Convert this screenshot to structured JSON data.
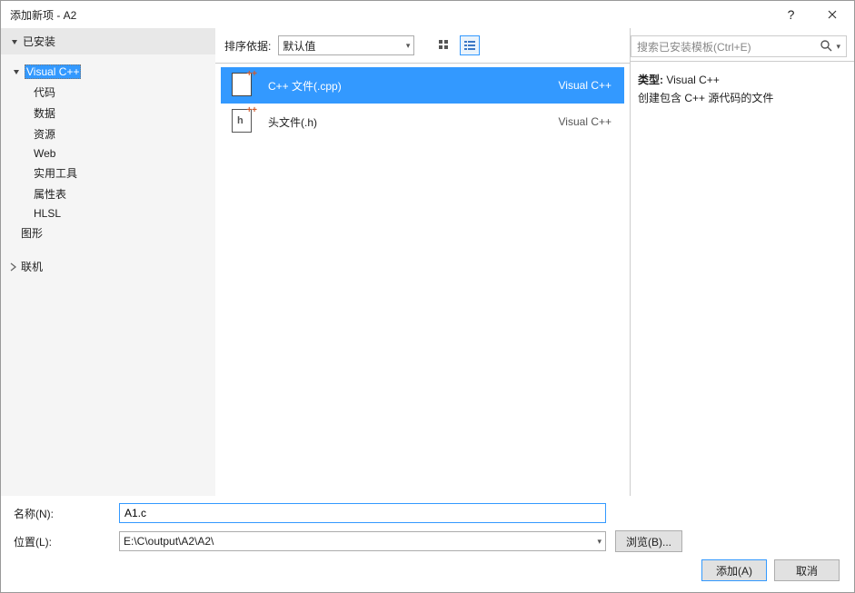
{
  "window": {
    "title": "添加新项 - A2"
  },
  "sidebar": {
    "installed_label": "已安装",
    "tree": {
      "vcpp_label": "Visual C++",
      "vcpp_children": [
        "代码",
        "数据",
        "资源",
        "Web",
        "实用工具",
        "属性表",
        "HLSL"
      ],
      "graphics_label": "图形"
    },
    "online_label": "联机"
  },
  "toolbar": {
    "sort_by_label": "排序依据:",
    "sort_value": "默认值"
  },
  "templates": [
    {
      "name": "C++ 文件(.cpp)",
      "category": "Visual C++",
      "icon": "cpp"
    },
    {
      "name": "头文件(.h)",
      "category": "Visual C++",
      "icon": "h"
    }
  ],
  "search": {
    "placeholder": "搜索已安装模板(Ctrl+E)"
  },
  "detail": {
    "type_label": "类型:",
    "type_value": "Visual C++",
    "description": "创建包含 C++ 源代码的文件"
  },
  "form": {
    "name_label": "名称(N):",
    "name_value": "A1.c",
    "location_label": "位置(L):",
    "location_value": "E:\\C\\output\\A2\\A2\\",
    "browse_label": "浏览(B)..."
  },
  "footer": {
    "add_label": "添加(A)",
    "cancel_label": "取消"
  }
}
